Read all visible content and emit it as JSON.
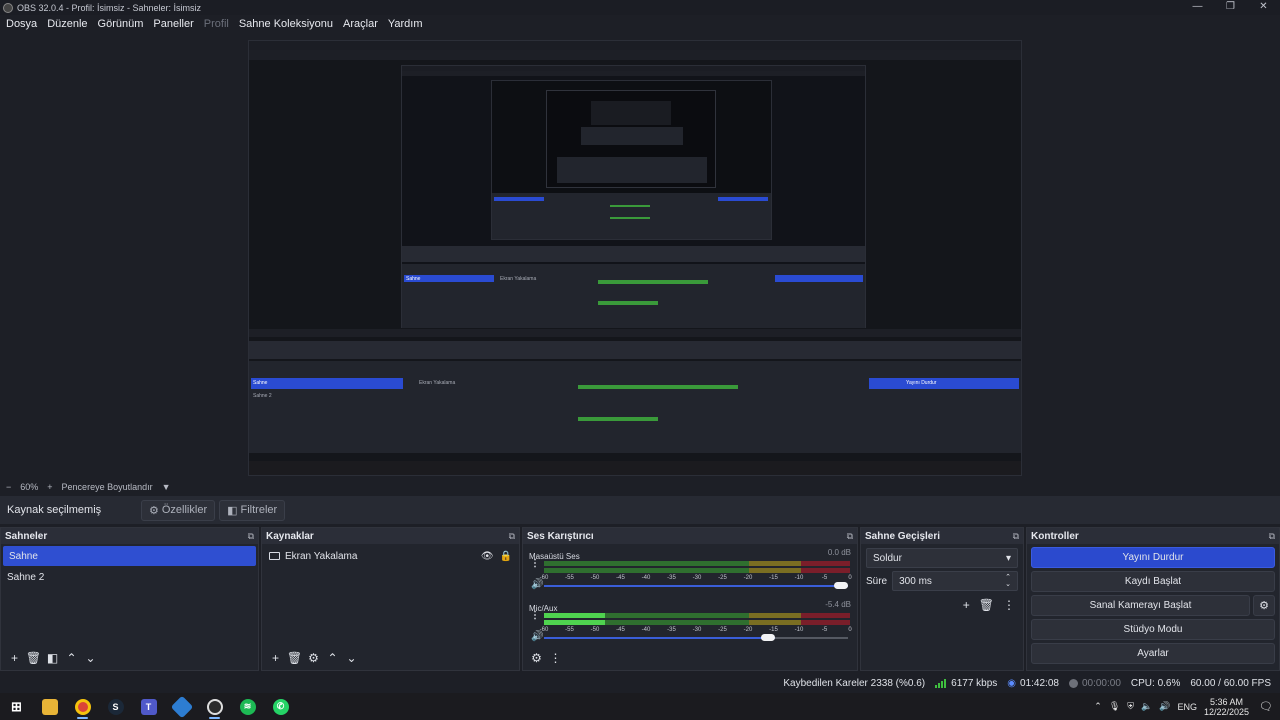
{
  "window": {
    "title": "OBS 32.0.4 - Profil: İsimsiz - Sahneler: İsimsiz",
    "controls": [
      "—",
      "❐",
      "✕"
    ]
  },
  "menu": [
    {
      "label": "Dosya",
      "enabled": true
    },
    {
      "label": "Düzenle",
      "enabled": true
    },
    {
      "label": "Görünüm",
      "enabled": true
    },
    {
      "label": "Paneller",
      "enabled": true
    },
    {
      "label": "Profil",
      "enabled": false
    },
    {
      "label": "Sahne Koleksiyonu",
      "enabled": true
    },
    {
      "label": "Araçlar",
      "enabled": true
    },
    {
      "label": "Yardım",
      "enabled": true
    }
  ],
  "zoom": {
    "minus": "−",
    "value": "60%",
    "plus": "+",
    "fit_label": "Pencereye Boyutlandır",
    "dropdown": "▼"
  },
  "context": {
    "no_selection": "Kaynak seçilmemiş",
    "properties": "Özellikler",
    "filters": "Filtreler"
  },
  "scenes": {
    "title": "Sahneler",
    "items": [
      {
        "label": "Sahne",
        "selected": true
      },
      {
        "label": "Sahne 2",
        "selected": false
      }
    ]
  },
  "sources": {
    "title": "Kaynaklar",
    "items": [
      {
        "label": "Ekran Yakalama",
        "visible": true,
        "locked": true
      }
    ]
  },
  "mixer": {
    "title": "Ses Karıştırıcı",
    "scale": [
      "-60",
      "-55",
      "-50",
      "-45",
      "-40",
      "-35",
      "-30",
      "-25",
      "-20",
      "-15",
      "-10",
      "-5",
      "0"
    ],
    "channels": [
      {
        "name": "Masaüstü Ses",
        "db": "0.0 dB",
        "level": 0.0,
        "volume": 1.0
      },
      {
        "name": "Mic/Aux",
        "db": "-5.4 dB",
        "level": 0.2,
        "volume": 0.76
      }
    ]
  },
  "transitions": {
    "title": "Sahne Geçişleri",
    "selected": "Soldur",
    "duration_label": "Süre",
    "duration_value": "300 ms"
  },
  "controls": {
    "title": "Kontroller",
    "stop_stream": "Yayını Durdur",
    "start_record": "Kaydı Başlat",
    "start_virtual_cam": "Sanal Kamerayı Başlat",
    "studio_mode": "Stüdyo Modu",
    "settings": "Ayarlar"
  },
  "status": {
    "dropped": "Kaybedilen Kareler 2338 (%0.6)",
    "bitrate": "6177 kbps",
    "stream_time": "01:42:08",
    "record_time": "00:00:00",
    "cpu": "CPU: 0.6%",
    "fps": "60.00 / 60.00 FPS"
  },
  "taskbar": {
    "lang": "ENG",
    "time": "5:36 AM",
    "date": "12/22/2025",
    "apps": [
      "windows-start",
      "file-explorer",
      "chrome",
      "steam",
      "teams",
      "network-app",
      "obs",
      "spotify",
      "whatsapp"
    ]
  },
  "colors": {
    "accent": "#2b4ace",
    "selected": "#2f4fd1",
    "meter_green": "#4fd34f",
    "meter_yellow": "#7a6e22",
    "meter_red": "#7a1e2a"
  }
}
